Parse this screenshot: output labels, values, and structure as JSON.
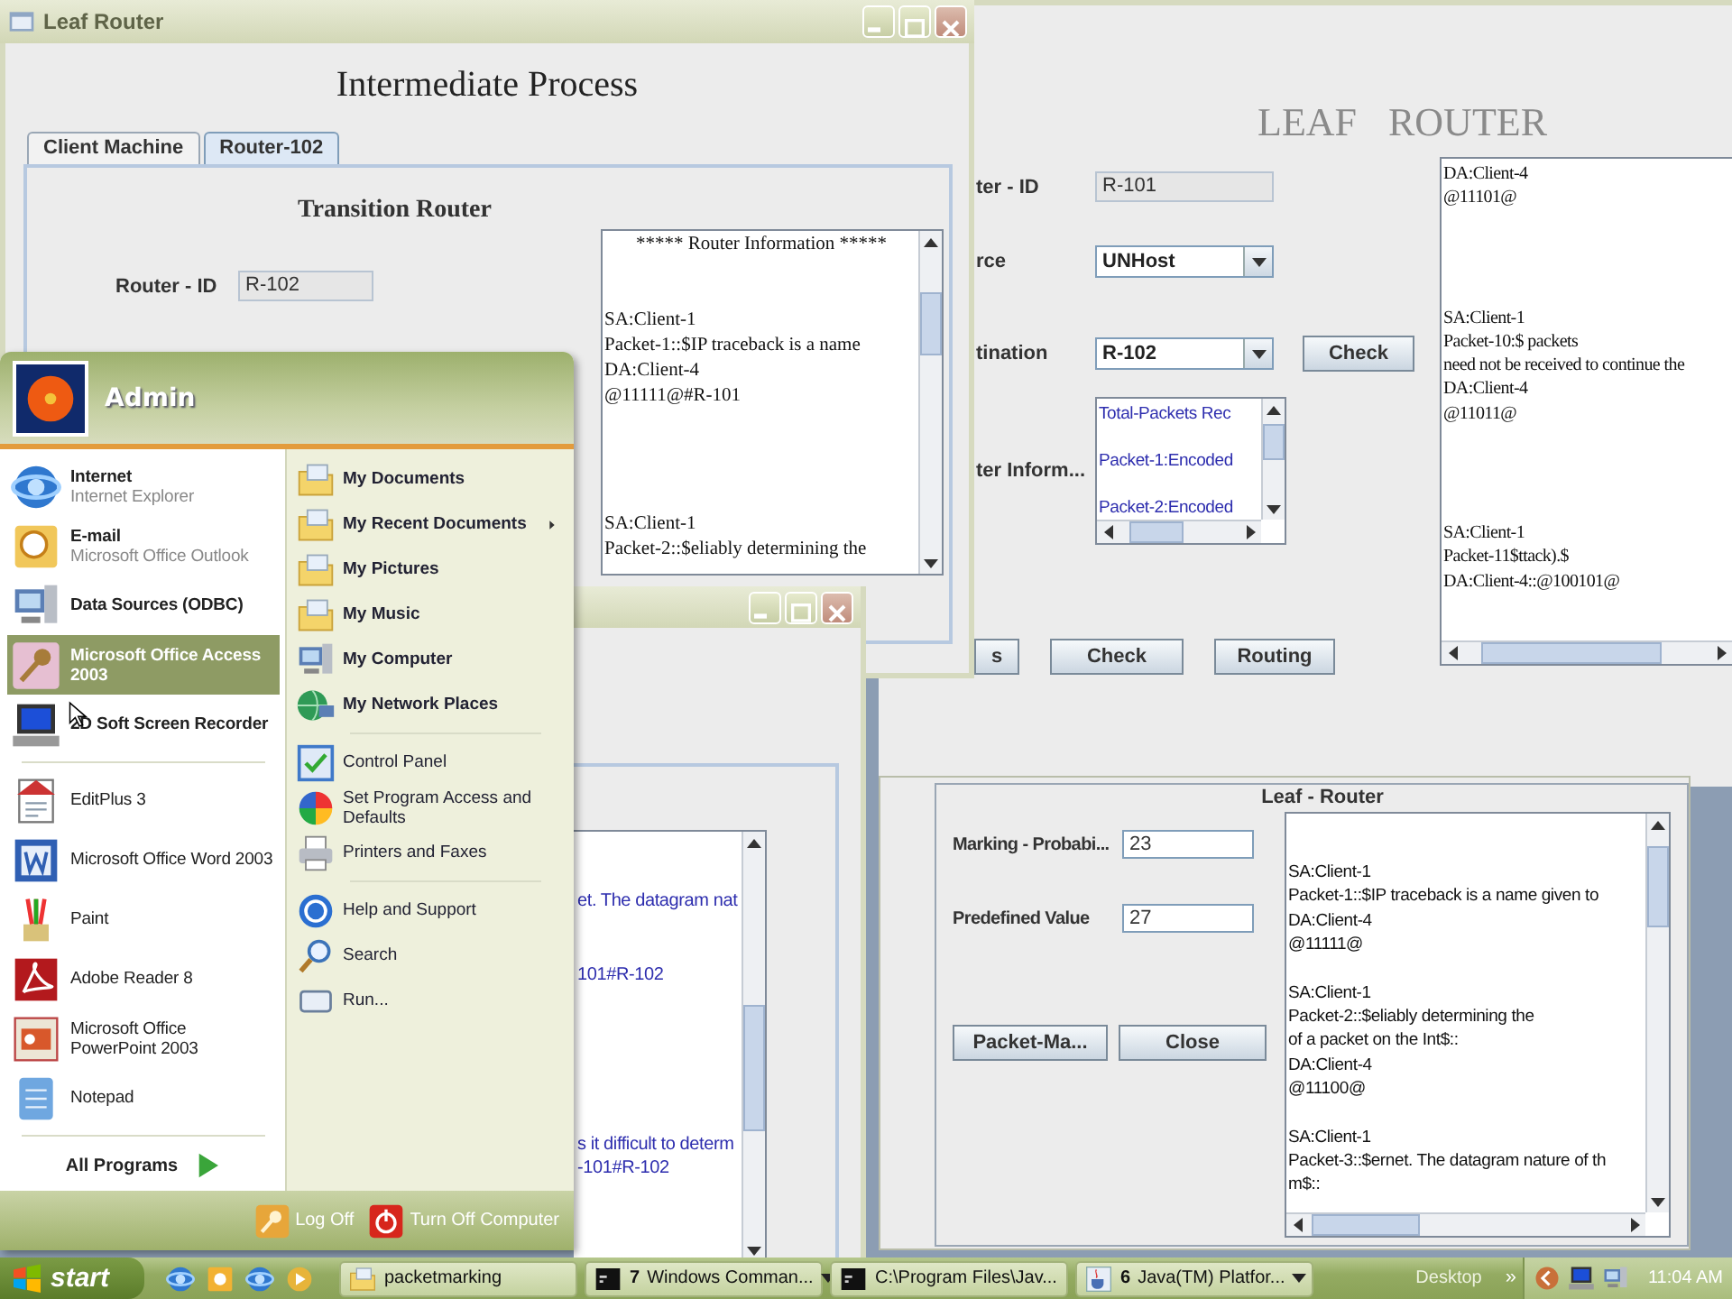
{
  "leaf_router_window": {
    "heading": "LEAF ROUTER",
    "labels": [
      "ter - ID",
      "rce",
      "tination",
      "ter Inform..."
    ],
    "router_id": "R-101",
    "source": "UNHost",
    "destination": "R-102",
    "check_button": "Check",
    "info_list": [
      "Total-Packets Rec",
      "Packet-1:Encoded",
      "Packet-2:Encoded"
    ],
    "buttons": [
      "s",
      "Check",
      "Routing"
    ],
    "log": [
      {
        "lines": [
          "DA:Client-4",
          "@11101@"
        ]
      },
      {
        "lines": [
          "SA:Client-1",
          "Packet-10:$ packets",
          "need not be received to continue the",
          "DA:Client-4",
          "@11011@"
        ]
      },
      {
        "lines": [
          "SA:Client-1",
          "Packet-11$ttack).$",
          "DA:Client-4::@100101@"
        ]
      }
    ]
  },
  "packet_marking_window": {
    "group_title": "Leaf - Router",
    "fields": [
      {
        "label": "Marking - Probabi...",
        "value": "23"
      },
      {
        "label": "Predefined Value",
        "value": "27"
      }
    ],
    "buttons": [
      "Packet-Ma...",
      "Close"
    ],
    "log": [
      {
        "lines": [
          "SA:Client-1",
          "Packet-1::$IP traceback is a name given to",
          "DA:Client-4",
          "@11111@"
        ]
      },
      {
        "lines": [
          "SA:Client-1",
          "Packet-2::$eliably determining the",
          " of a packet on the Int$::",
          "DA:Client-4",
          "@11100@"
        ]
      },
      {
        "lines": [
          "SA:Client-1",
          "Packet-3::$ernet. The datagram nature of th",
          "m$::"
        ]
      }
    ]
  },
  "background_window": {
    "log": [
      {
        "lines": [
          "et. The datagram nat"
        ]
      },
      {
        "lines": [
          "101#R-102"
        ]
      },
      {
        "lines": [
          "s it difficult to determ",
          "-101#R-102"
        ]
      }
    ]
  },
  "intermediate_window": {
    "title": "Leaf Router",
    "heading": "Intermediate Process",
    "tabs": [
      {
        "label": "Client Machine",
        "selected": false
      },
      {
        "label": "Router-102",
        "selected": true
      }
    ],
    "panel_title": "Transition Router",
    "router_id_label": "Router - ID",
    "router_id": "R-102",
    "info_header": "***** Router Information *****",
    "log": [
      {
        "lines": [
          "SA:Client-1",
          "Packet-1::$IP traceback is a name",
          "DA:Client-4",
          "@11111@#R-101"
        ]
      },
      {
        "lines": [
          "SA:Client-1",
          "Packet-2::$eliably determining the"
        ]
      }
    ]
  },
  "start_menu": {
    "user": "Admin",
    "pinned": [
      {
        "title": "Internet",
        "subtitle": "Internet Explorer",
        "selected": false
      },
      {
        "title": "E-mail",
        "subtitle": "Microsoft Office Outlook",
        "selected": false
      },
      {
        "title": "Data Sources (ODBC)",
        "selected": false
      },
      {
        "title": "Microsoft Office Access 2003",
        "selected": true
      },
      {
        "title": "2D Soft Screen Recorder",
        "selected": false
      }
    ],
    "recent": [
      {
        "title": "EditPlus 3",
        "selected": false
      },
      {
        "title": "Microsoft Office Word 2003",
        "selected": false
      },
      {
        "title": "Paint",
        "selected": false
      },
      {
        "title": "Adobe Reader 8",
        "selected": false
      },
      {
        "title": "Microsoft Office PowerPoint 2003",
        "selected": false
      },
      {
        "title": "Notepad",
        "selected": false
      }
    ],
    "all_programs": "All Programs",
    "places": [
      {
        "label": "My Documents",
        "submenu": false
      },
      {
        "label": "My Recent Documents",
        "submenu": true
      },
      {
        "label": "My Pictures",
        "submenu": false
      },
      {
        "label": "My Music",
        "submenu": false
      },
      {
        "label": "My Computer",
        "submenu": false
      },
      {
        "label": "My Network Places",
        "submenu": false
      }
    ],
    "system": [
      "Control Panel",
      "Set Program Access and Defaults",
      "Printers and Faxes"
    ],
    "tools": [
      "Help and Support",
      "Search",
      "Run..."
    ],
    "footer": [
      "Log Off",
      "Turn Off Computer"
    ]
  },
  "taskbar": {
    "start": "start",
    "tasks": [
      {
        "label": "packetmarking"
      },
      {
        "count": "7",
        "label": "Windows Comman..."
      },
      {
        "label": "C:\\Program Files\\Jav..."
      },
      {
        "count": "6",
        "label": "Java(TM) Platfor..."
      }
    ],
    "toolbar_label": "Desktop",
    "toolbar_expand": "»",
    "clock": "11:04 AM"
  }
}
